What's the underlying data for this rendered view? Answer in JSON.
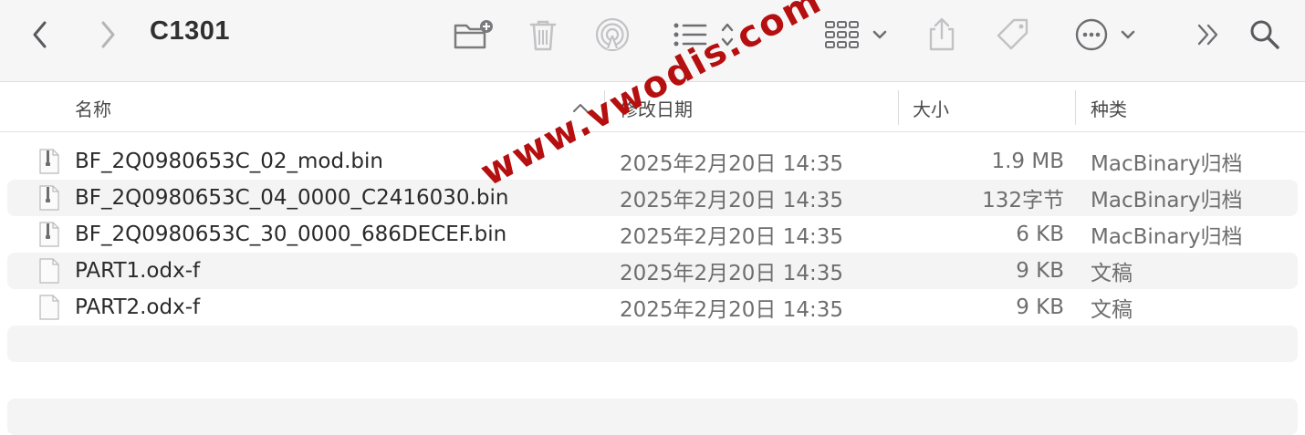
{
  "window": {
    "title": "C1301"
  },
  "toolbar": {
    "back_icon": "chevron-left-icon",
    "forward_icon": "chevron-right-icon",
    "new_folder_icon": "new-folder-icon",
    "trash_icon": "trash-icon",
    "airdrop_icon": "airdrop-icon",
    "list_view_icon": "list-view-icon",
    "group_icon": "grid-group-icon",
    "share_icon": "share-icon",
    "tag_icon": "tag-icon",
    "more_icon": "ellipsis-circle-icon",
    "overflow_icon": "double-chevron-icon",
    "search_icon": "search-icon"
  },
  "columns": {
    "name": "名称",
    "date": "修改日期",
    "size": "大小",
    "kind": "种类"
  },
  "files": [
    {
      "name": "BF_2Q0980653C_02_mod.bin",
      "date": "2025年2月20日 14:35",
      "size": "1.9 MB",
      "kind": "MacBinary归档",
      "icon": "binary-file-icon"
    },
    {
      "name": "BF_2Q0980653C_04_0000_C2416030.bin",
      "date": "2025年2月20日 14:35",
      "size": "132字节",
      "kind": "MacBinary归档",
      "icon": "binary-file-icon"
    },
    {
      "name": "BF_2Q0980653C_30_0000_686DECEF.bin",
      "date": "2025年2月20日 14:35",
      "size": "6 KB",
      "kind": "MacBinary归档",
      "icon": "binary-file-icon"
    },
    {
      "name": "PART1.odx-f",
      "date": "2025年2月20日 14:35",
      "size": "9 KB",
      "kind": "文稿",
      "icon": "document-icon"
    },
    {
      "name": "PART2.odx-f",
      "date": "2025年2月20日 14:35",
      "size": "9 KB",
      "kind": "文稿",
      "icon": "document-icon"
    }
  ],
  "watermark": "www.vwodis.com",
  "colors": {
    "toolbar_bg": "#f6f6f7",
    "row_alt": "#f4f4f5",
    "icon_gray": "#7b7b7e",
    "watermark": "#b50f0f"
  }
}
